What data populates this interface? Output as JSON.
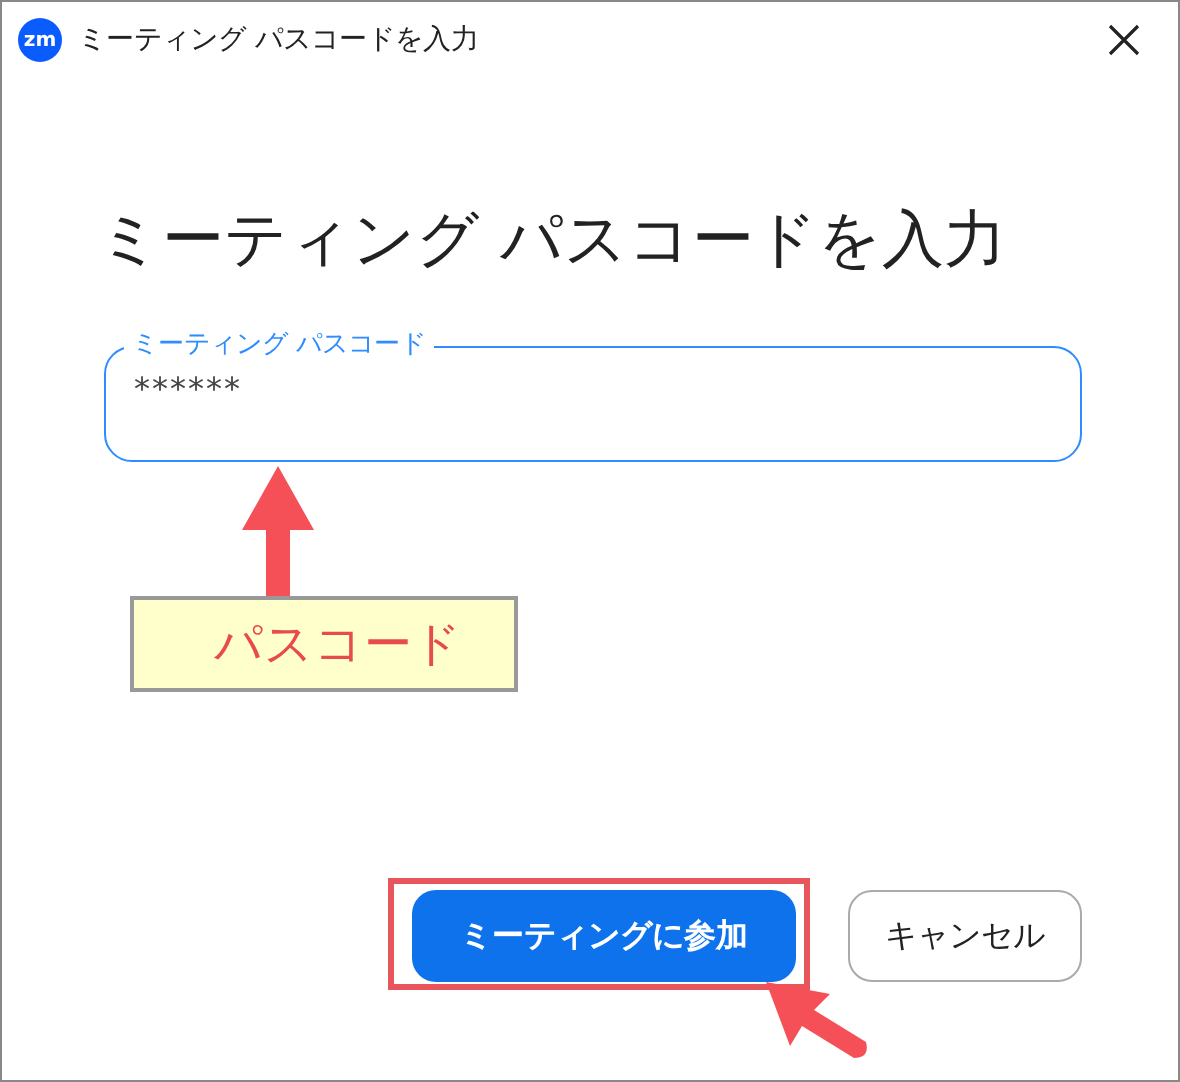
{
  "window": {
    "title": "ミーティング パスコードを入力",
    "app_icon": "zm"
  },
  "heading": "ミーティング パスコードを入力",
  "passcode_field": {
    "label": "ミーティング パスコード",
    "value": "******",
    "focused": true
  },
  "buttons": [
    {
      "label": "ミーティングに参加",
      "kind": "primary"
    },
    {
      "label": "キャンセル",
      "kind": "secondary"
    }
  ],
  "annotation": {
    "callout": "パスコード"
  }
}
